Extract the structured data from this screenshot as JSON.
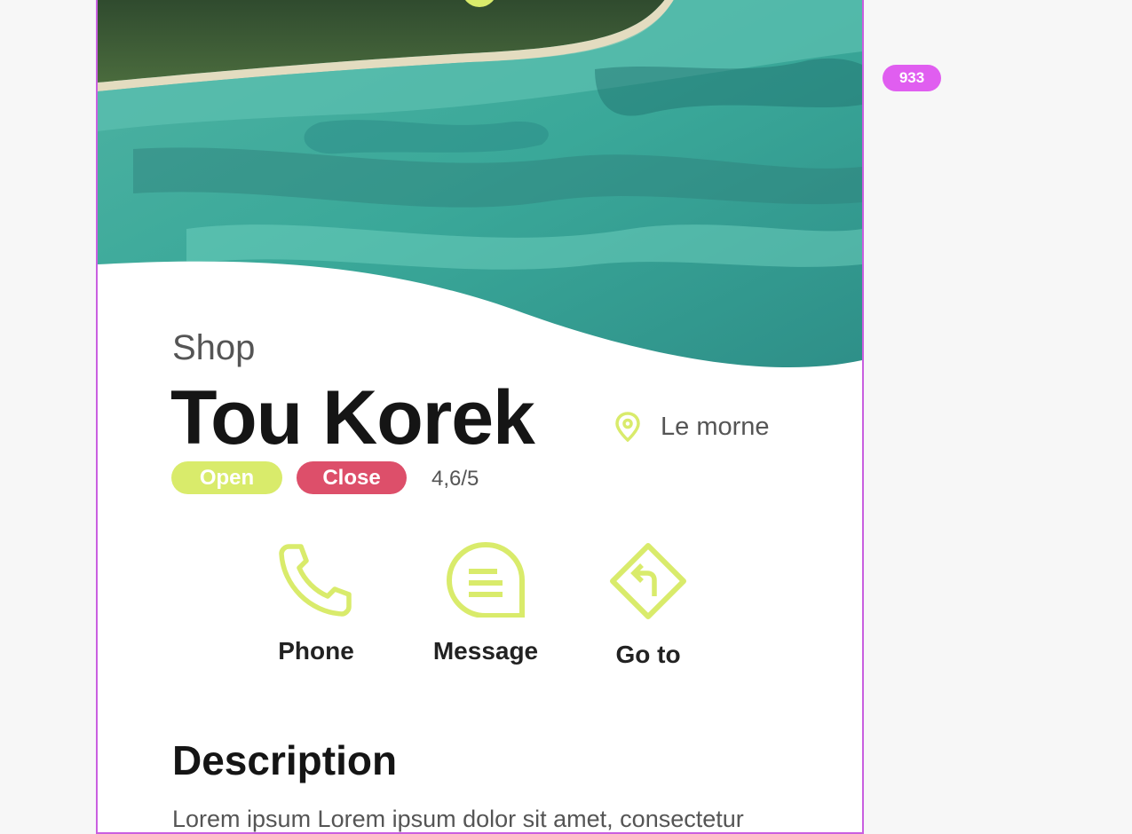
{
  "badge": {
    "text": "933"
  },
  "shop": {
    "category": "Shop",
    "name": "Tou Korek",
    "location": "Le morne",
    "status_open": "Open",
    "status_close": "Close",
    "rating": "4,6/5"
  },
  "actions": [
    {
      "label": "Phone",
      "icon": "phone-icon"
    },
    {
      "label": "Message",
      "icon": "message-icon"
    },
    {
      "label": "Go to",
      "icon": "directions-icon"
    }
  ],
  "description": {
    "title": "Description",
    "text": "Lorem ipsum Lorem ipsum dolor sit amet, consectetur"
  },
  "colors": {
    "accent": "#d9eb6b",
    "close": "#dd4f6a",
    "badge": "#e05ef0",
    "frame": "#c95fe0"
  }
}
